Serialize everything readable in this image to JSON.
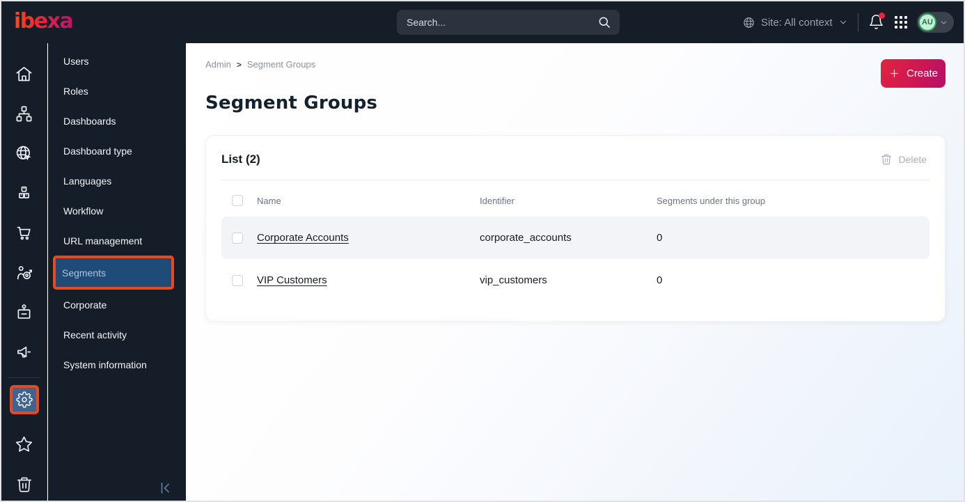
{
  "topbar": {
    "logo_text": "ibexa",
    "search_placeholder": "Search...",
    "site_label": "Site: All context",
    "avatar_initials": "AU"
  },
  "nav_rail": {
    "items": [
      "home",
      "content-tree",
      "site",
      "product-catalog",
      "commerce",
      "personalization",
      "corporate",
      "campaigns",
      "settings",
      "bookmarks",
      "trash"
    ],
    "active_item": "settings"
  },
  "menu": {
    "items": [
      "Users",
      "Roles",
      "Dashboards",
      "Dashboard type",
      "Languages",
      "Workflow",
      "URL management",
      "Segments",
      "Corporate",
      "Recent activity",
      "System information"
    ],
    "active_item": "Segments"
  },
  "main": {
    "breadcrumb": [
      "Admin",
      "Segment Groups"
    ],
    "create_button": "Create",
    "page_title": "Segment Groups",
    "list_card": {
      "title": "List (2)",
      "delete_button": "Delete",
      "columns": [
        "Name",
        "Identifier",
        "Segments under this group"
      ],
      "rows": [
        {
          "name": "Corporate Accounts",
          "identifier": "corporate_accounts",
          "segments_count": "0",
          "highlighted": true
        },
        {
          "name": "VIP Customers",
          "identifier": "vip_customers",
          "segments_count": "0",
          "highlighted": false
        }
      ]
    }
  },
  "colors": {
    "topbar_bg": "#141d28",
    "annotation_orange": "#e8491f",
    "active_menu_blue": "#1e4b77",
    "rail_active_blue": "#40648f",
    "accent_gradient_start": "#e0243f",
    "accent_gradient_end": "#b50e6b",
    "avatar_green": "#2f9e5f",
    "notification_red": "#e8253e"
  }
}
